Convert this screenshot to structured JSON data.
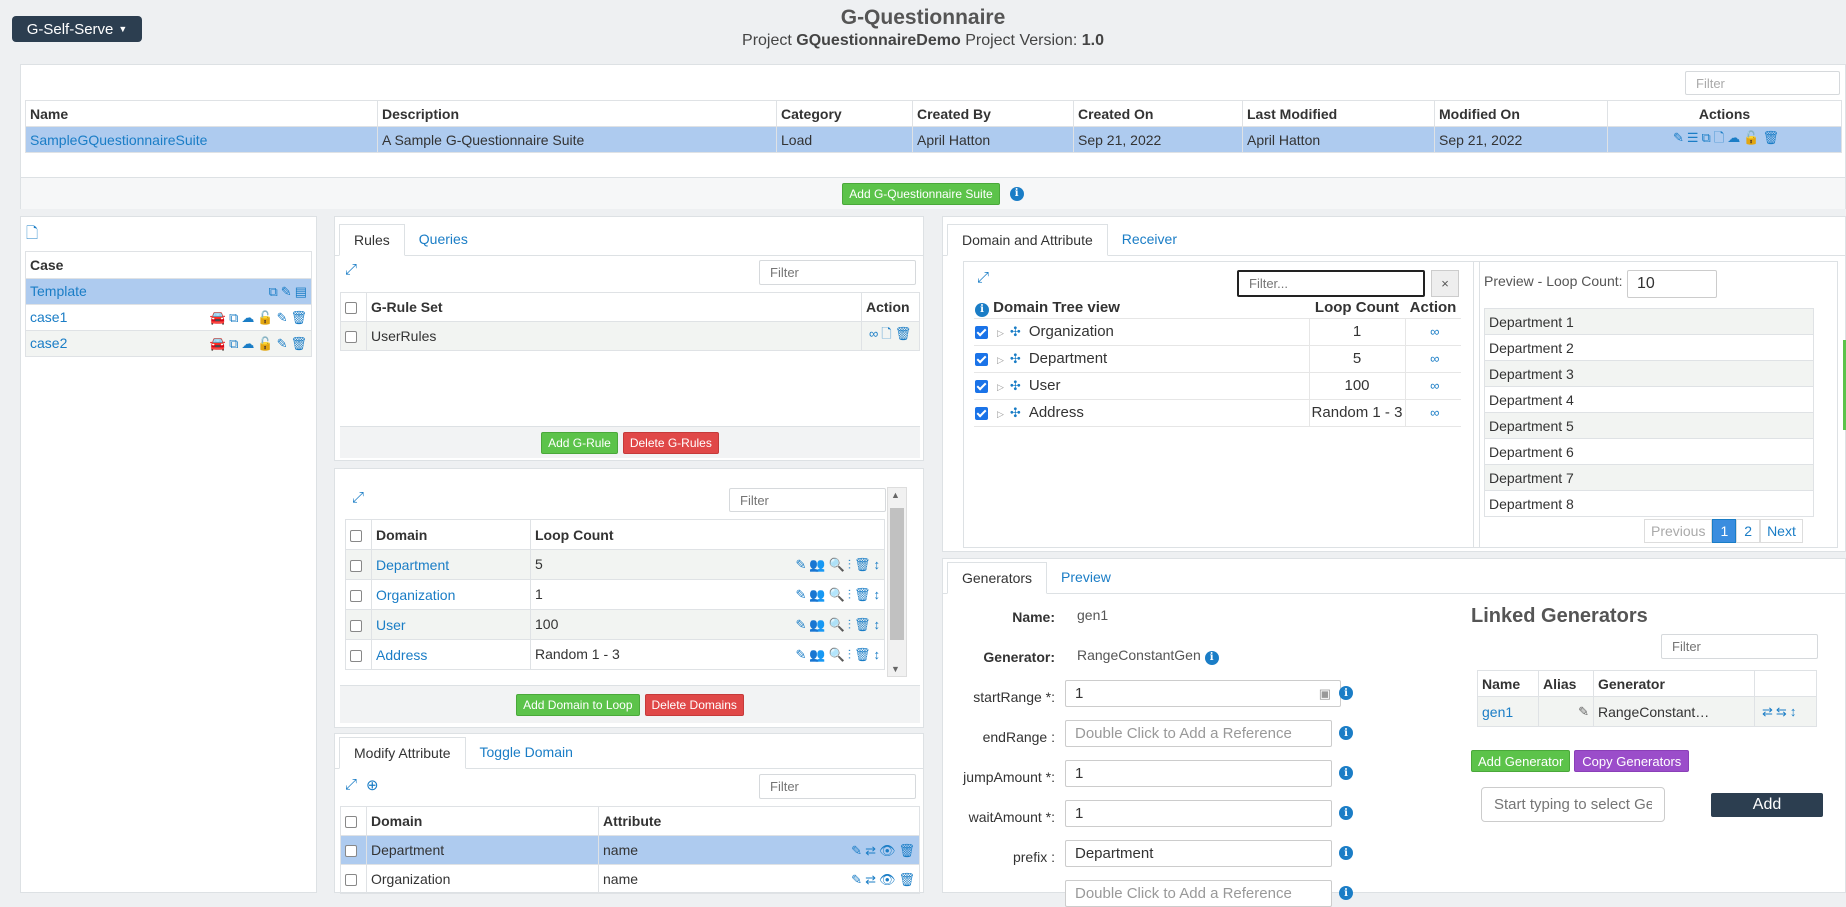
{
  "app_menu": "G-Self-Serve",
  "header": {
    "title": "G-Questionnaire",
    "project_label": "Project",
    "project_name": "GQuestionnaireDemo",
    "version_label": "Project Version:",
    "version": "1.0"
  },
  "suite_table": {
    "filter_placeholder": "Filter",
    "columns": [
      "Name",
      "Description",
      "Category",
      "Created By",
      "Created On",
      "Last Modified",
      "Modified On",
      "Actions"
    ],
    "rows": [
      [
        "SampleGQuestionnaireSuite",
        "A Sample G-Questionnaire Suite",
        "Load",
        "April Hatton",
        "Sep 21, 2022",
        "April Hatton",
        "Sep 21, 2022"
      ]
    ],
    "add_button": "Add G-Questionnaire Suite"
  },
  "case_panel": {
    "header": "Case",
    "rows": [
      "Template",
      "case1",
      "case2"
    ]
  },
  "rules_panel": {
    "tabs": [
      "Rules",
      "Queries"
    ],
    "filter_placeholder": "Filter",
    "columns": [
      "G-Rule Set",
      "Action"
    ],
    "rows": [
      "UserRules"
    ],
    "add_button": "Add G-Rule",
    "delete_button": "Delete G-Rules"
  },
  "domain_loop_panel": {
    "filter_placeholder": "Filter",
    "columns": [
      "Domain",
      "Loop Count"
    ],
    "rows": [
      [
        "Department",
        "5"
      ],
      [
        "Organization",
        "1"
      ],
      [
        "User",
        "100"
      ],
      [
        "Address",
        "Random 1 - 3"
      ]
    ],
    "add_button": "Add Domain to Loop",
    "delete_button": "Delete Domains"
  },
  "attribute_panel": {
    "tabs": [
      "Modify Attribute",
      "Toggle Domain"
    ],
    "filter_placeholder": "Filter",
    "columns": [
      "Domain",
      "Attribute"
    ],
    "rows": [
      [
        "Department",
        "name"
      ],
      [
        "Organization",
        "name"
      ]
    ]
  },
  "domain_tree_panel": {
    "tabs": [
      "Domain and Attribute",
      "Receiver"
    ],
    "filter_placeholder": "Filter...",
    "clear": "×",
    "columns": [
      "Domain Tree view",
      "Loop Count",
      "Action"
    ],
    "rows": [
      [
        "Organization",
        "1"
      ],
      [
        "Department",
        "5"
      ],
      [
        "User",
        "100"
      ],
      [
        "Address",
        "Random 1 - 3"
      ]
    ]
  },
  "preview_panel": {
    "label": "Preview - Loop Count:",
    "loop_count": "10",
    "rows": [
      "Department 1",
      "Department 2",
      "Department 3",
      "Department 4",
      "Department 5",
      "Department 6",
      "Department 7",
      "Department 8"
    ],
    "pagination": [
      "Previous",
      "1",
      "2",
      "Next"
    ]
  },
  "generators_panel": {
    "tabs": [
      "Generators",
      "Preview"
    ],
    "name_label": "Name:",
    "name_value": "gen1",
    "generator_label": "Generator:",
    "generator_value": "RangeConstantGen",
    "fields": [
      {
        "label": "startRange *:",
        "value": "1",
        "placeholder": ""
      },
      {
        "label": "endRange :",
        "value": "",
        "placeholder": "Double Click to Add a Reference"
      },
      {
        "label": "jumpAmount *:",
        "value": "1",
        "placeholder": ""
      },
      {
        "label": "waitAmount *:",
        "value": "1",
        "placeholder": ""
      },
      {
        "label": "prefix :",
        "value": "Department",
        "placeholder": ""
      },
      {
        "label": "",
        "value": "",
        "placeholder": "Double Click to Add a Reference"
      }
    ]
  },
  "linked_generators": {
    "title": "Linked Generators",
    "filter_placeholder": "Filter",
    "columns": [
      "Name",
      "Alias",
      "Generator"
    ],
    "rows": [
      [
        "gen1",
        "",
        "RangeConstant…"
      ]
    ],
    "add_button": "Add Generator",
    "copy_button": "Copy Generators",
    "select_placeholder": "Start typing to select Gener",
    "add_label": "Add"
  }
}
